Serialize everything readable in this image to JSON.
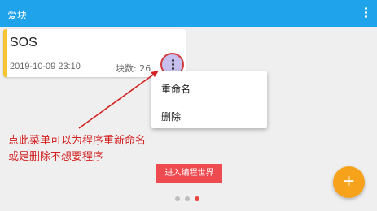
{
  "app": {
    "title": "爱块"
  },
  "card": {
    "title": "SOS",
    "date": "2019-10-09 23:10",
    "blocks": "块数: 26"
  },
  "menu": {
    "items": [
      {
        "label": "重命名"
      },
      {
        "label": "删除"
      }
    ]
  },
  "annotation": {
    "line1": "点此菜单可以为程序重新命名",
    "line2": "或是删除不想要程序"
  },
  "actions": {
    "enter_label": "进入编程世界",
    "fab_symbol": "+"
  },
  "pager": {
    "count": 3,
    "active_index": 2
  },
  "colors": {
    "appbar": "#1fa3ea",
    "card_stripe": "#f7c431",
    "annotation": "#d32020",
    "enter_button": "#ee4b50",
    "fab": "#f7a21b",
    "pager_active": "#e8453c",
    "pager_inactive": "#bdbdbd"
  },
  "icons": {
    "appbar_menu": "more-vert-icon",
    "card_more": "more-vert-icon",
    "fab": "plus-icon",
    "annotation_arrow": "arrow-icon"
  }
}
